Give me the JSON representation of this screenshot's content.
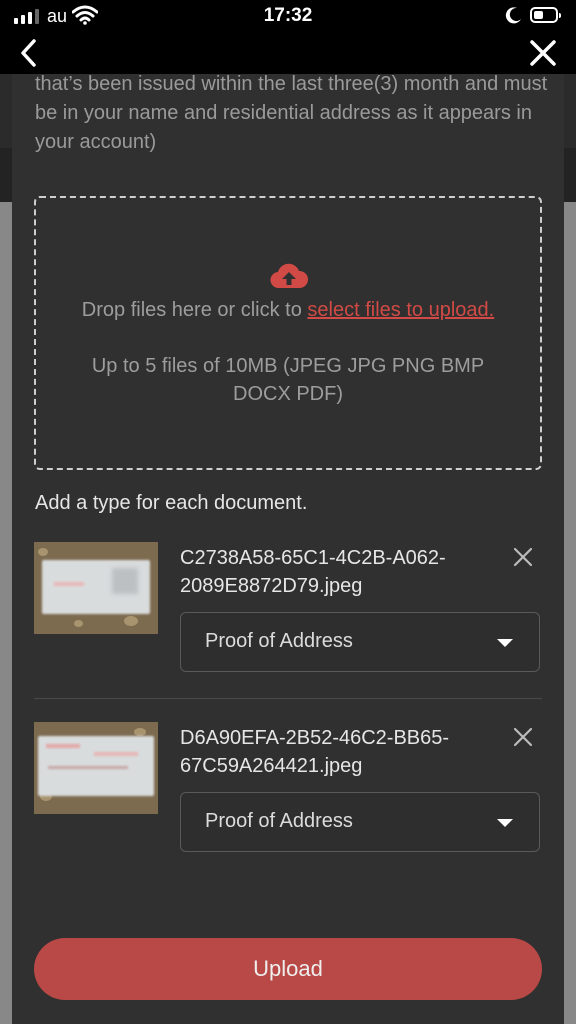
{
  "status_bar": {
    "carrier": "au",
    "time": "17:32",
    "battery_level": 0.45
  },
  "nav": {
    "back_icon": "chevron-left-icon",
    "close_icon": "close-icon"
  },
  "instruction": "that’s been issued within the last three(3) month and must be in your name and residential address as it appears in your account)",
  "dropzone": {
    "prompt": "Drop files here or click to ",
    "link": "select files to upload.",
    "limits": "Up to 5 files of 10MB (JPEG JPG PNG BMP DOCX PDF)",
    "icon": "cloud-upload-icon",
    "accent": "#d14a45"
  },
  "type_hint": "Add a type for each document.",
  "documents": [
    {
      "filename": "C2738A58-65C1-4C2B-A062-2089E8872D79.jpeg",
      "type": "Proof of Address"
    },
    {
      "filename": "D6A90EFA-2B52-46C2-BB65-67C59A264421.jpeg",
      "type": "Proof of Address"
    }
  ],
  "upload_button": "Upload",
  "colors": {
    "modal_bg": "#303030",
    "button": "#b84946"
  }
}
